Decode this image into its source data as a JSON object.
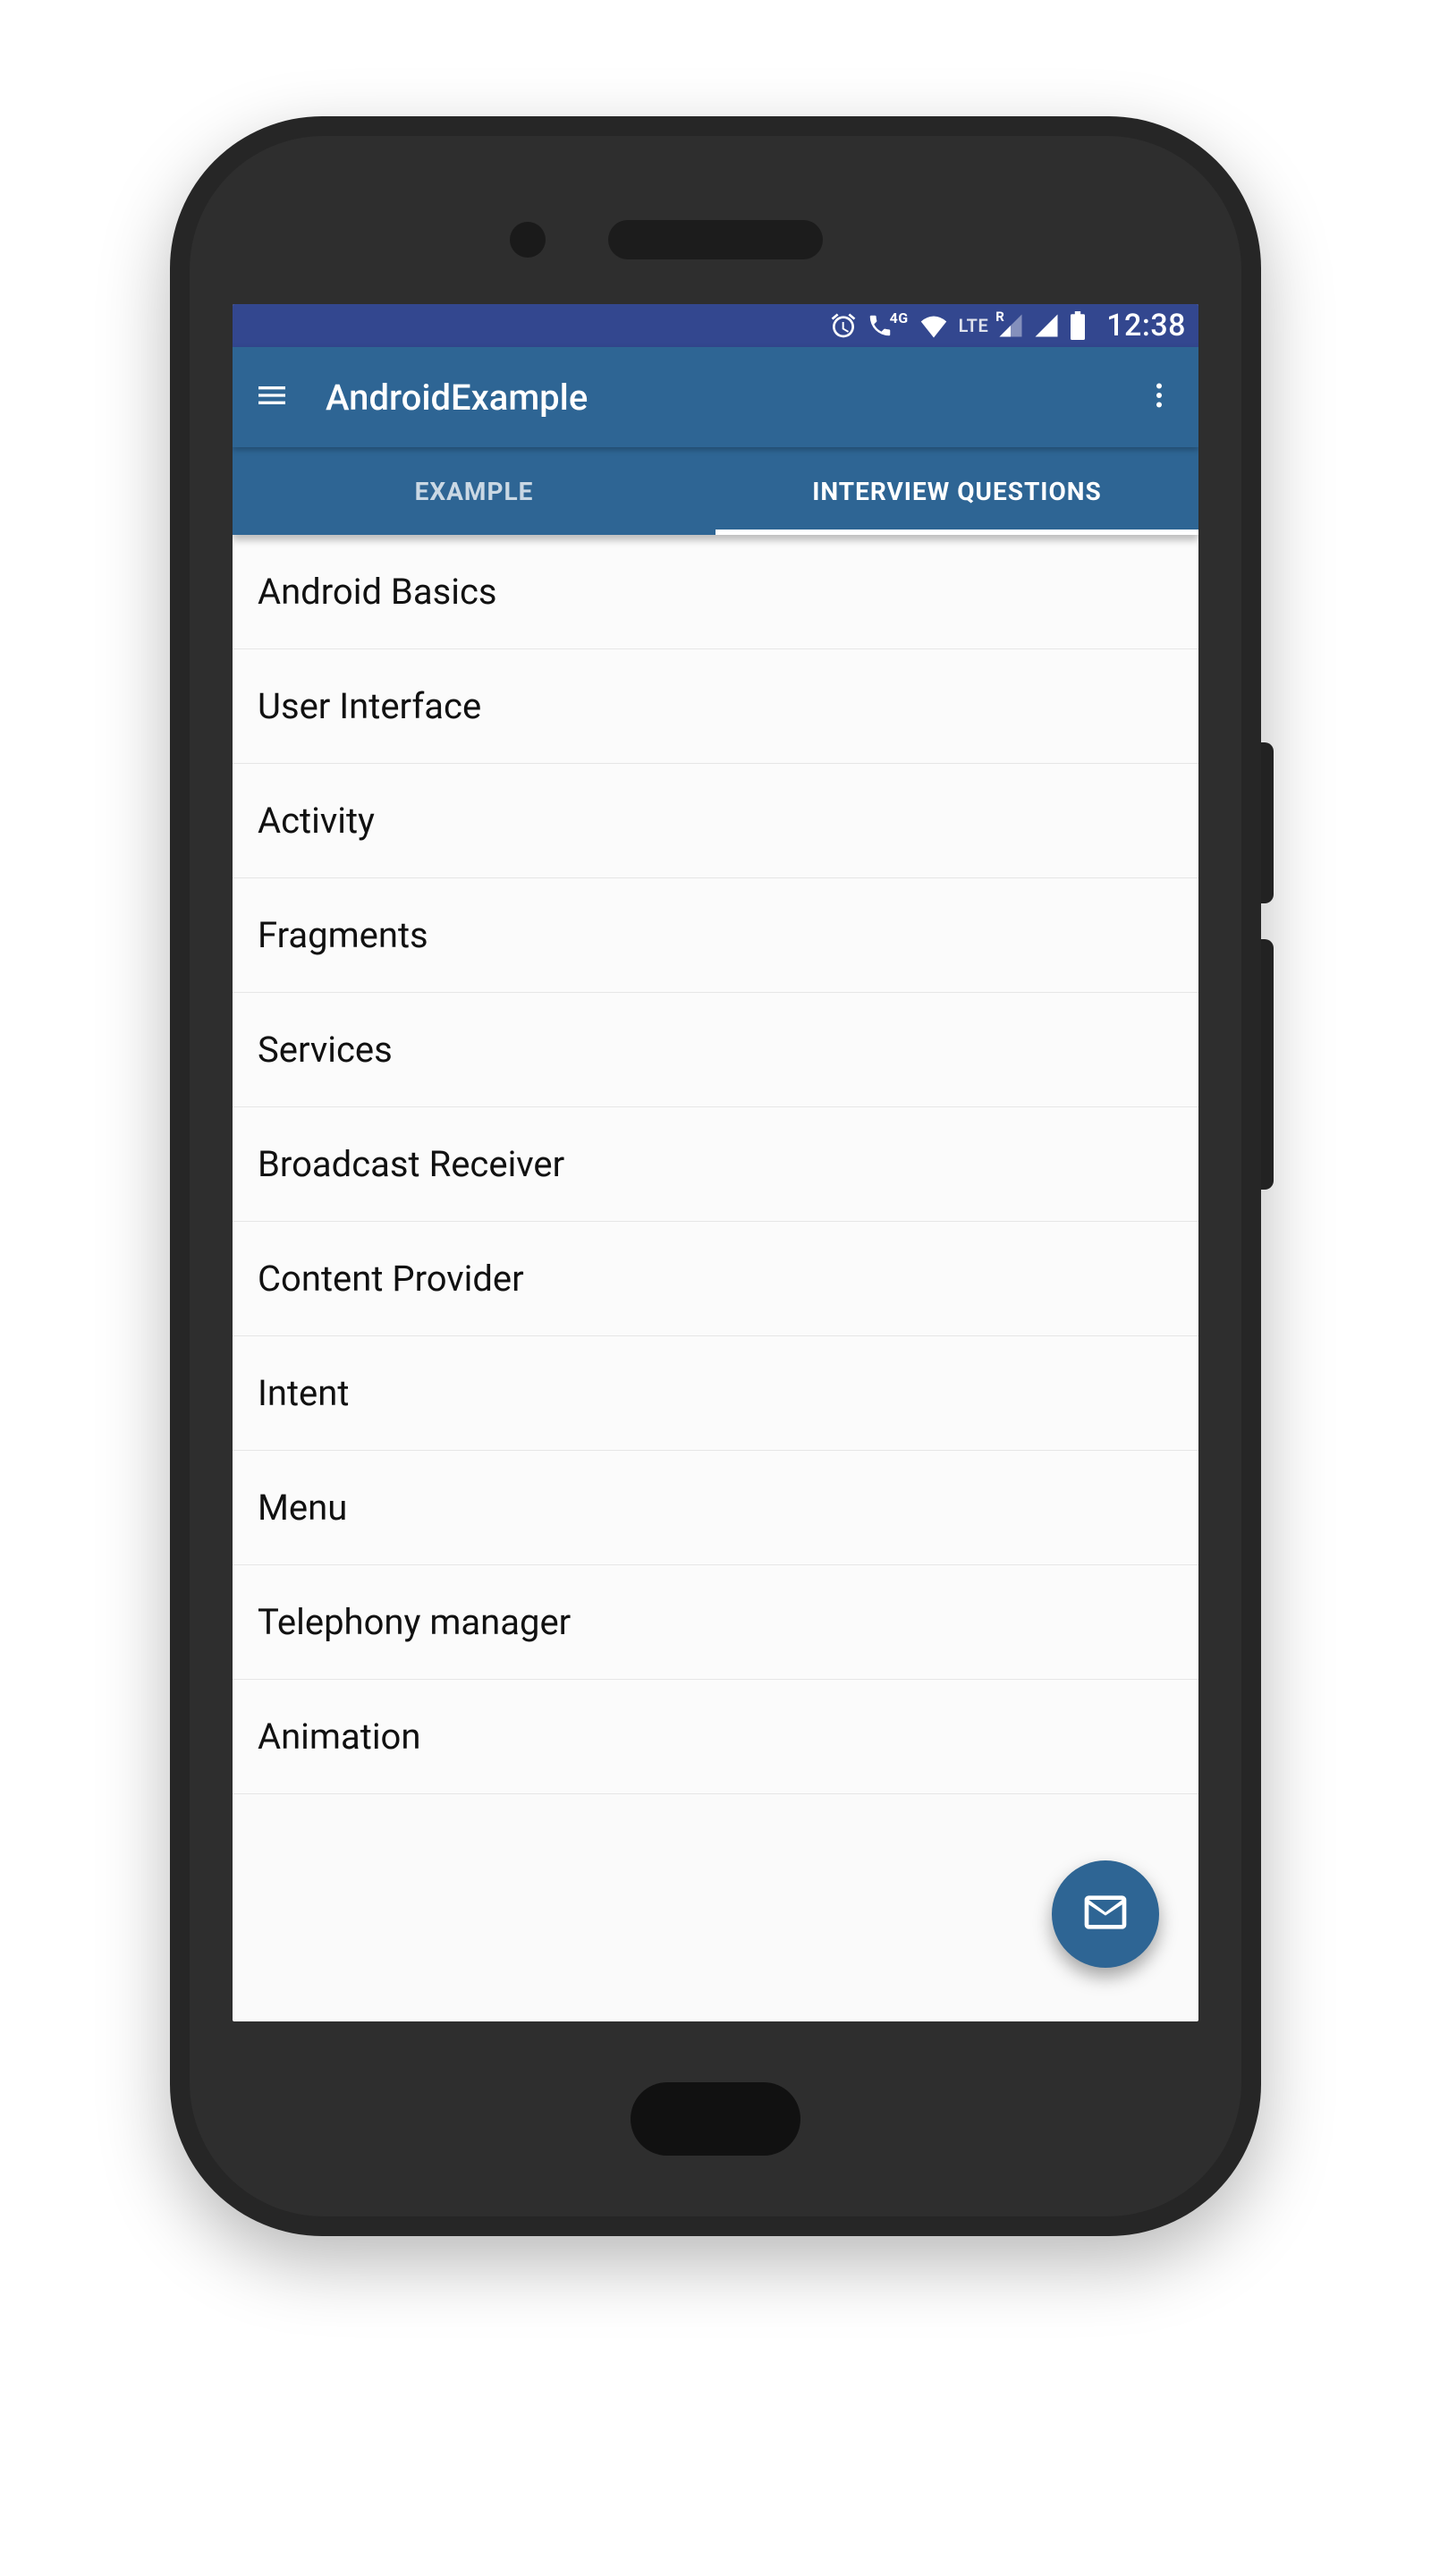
{
  "colors": {
    "status_bar": "#33478f",
    "primary": "#2e6594",
    "background": "#fafafa",
    "divider": "#e6e6e6",
    "text": "#111111",
    "on_primary": "#ffffff"
  },
  "status": {
    "time": "12:38",
    "network_label": "LTE",
    "data_label": "4G",
    "roaming_label": "R"
  },
  "app_bar": {
    "title": "AndroidExample"
  },
  "tabs": [
    {
      "label": "EXAMPLE",
      "active": false
    },
    {
      "label": "INTERVIEW QUESTIONS",
      "active": true
    }
  ],
  "list": {
    "items": [
      "Android Basics",
      "User Interface",
      "Activity",
      "Fragments",
      "Services",
      "Broadcast Receiver",
      "Content Provider",
      "Intent",
      "Menu",
      "Telephony manager",
      "Animation"
    ]
  },
  "fab": {
    "icon": "mail-icon"
  }
}
